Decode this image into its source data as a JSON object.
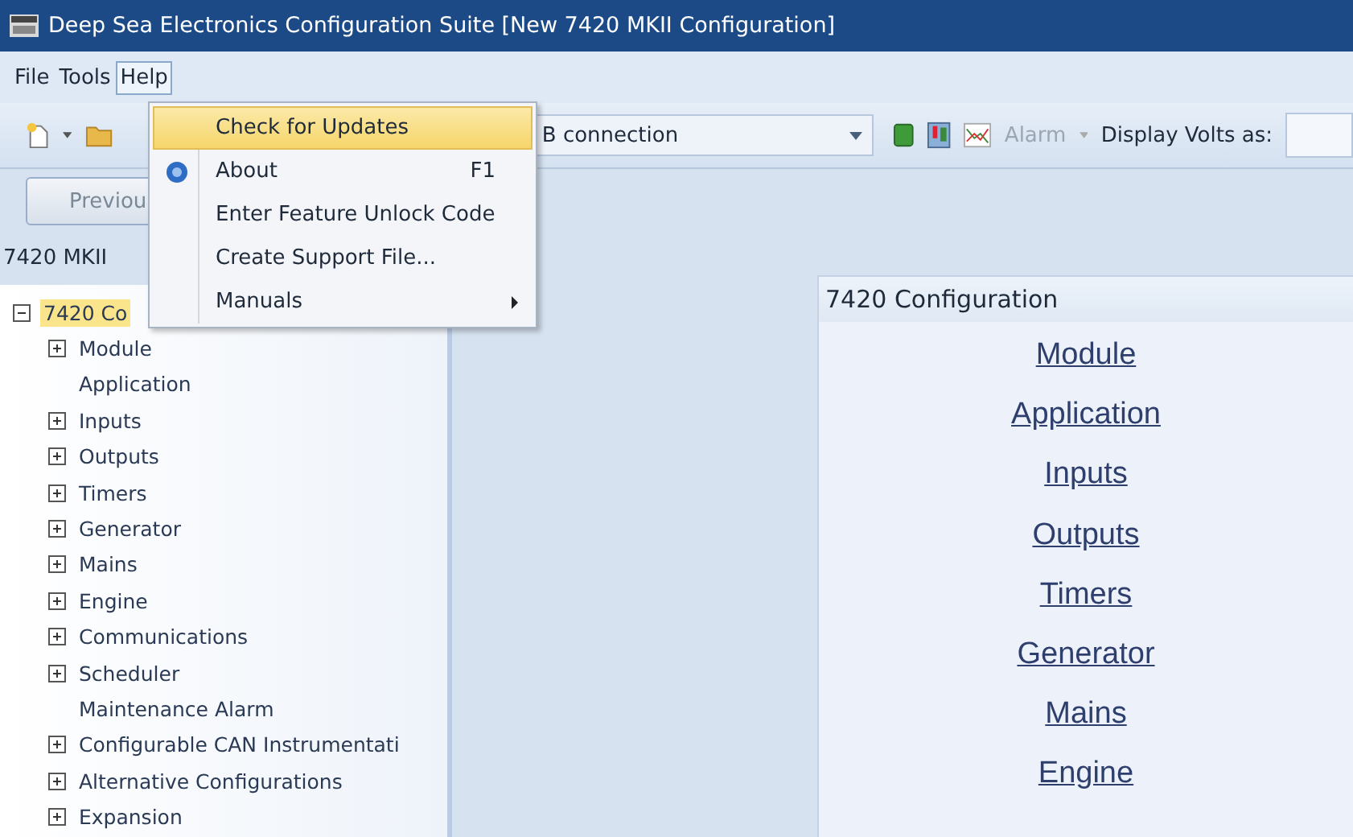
{
  "window": {
    "title": "Deep Sea Electronics Configuration Suite [New 7420 MKII Configuration]"
  },
  "menu_bar": [
    {
      "label": "File",
      "selected": false
    },
    {
      "label": "Tools",
      "selected": false
    },
    {
      "label": "Help",
      "selected": true
    }
  ],
  "help_menu": [
    {
      "label": "Check for Updates",
      "selected": true,
      "icon": false
    },
    {
      "label": "About",
      "shortcut": "F1",
      "selected": false,
      "icon": true
    },
    {
      "label": "Enter Feature Unlock Code",
      "selected": false,
      "icon": false
    },
    {
      "label": "Create Support File...",
      "selected": false,
      "icon": false
    },
    {
      "label": "Manuals",
      "submenu": true,
      "selected": false,
      "icon": false
    }
  ],
  "toolbar": {
    "connection": "B connection",
    "alarm": {
      "label": "Alarm",
      "disabled": true
    },
    "volts_label": "Display Volts as:"
  },
  "previous_button": "Previou",
  "tree": {
    "header": "7420 MKII",
    "root": {
      "label": "7420 Co",
      "selected": true,
      "expanded": true,
      "children": [
        {
          "label": "Module",
          "kind": "group"
        },
        {
          "label": "Application",
          "kind": "leaf"
        },
        {
          "label": "Inputs",
          "kind": "group"
        },
        {
          "label": "Outputs",
          "kind": "group"
        },
        {
          "label": "Timers",
          "kind": "group"
        },
        {
          "label": "Generator",
          "kind": "group"
        },
        {
          "label": "Mains",
          "kind": "group"
        },
        {
          "label": "Engine",
          "kind": "group"
        },
        {
          "label": "Communications",
          "kind": "group"
        },
        {
          "label": "Scheduler",
          "kind": "group"
        },
        {
          "label": "Maintenance Alarm",
          "kind": "leaf"
        },
        {
          "label": "Configurable CAN Instrumentati",
          "kind": "group"
        },
        {
          "label": "Alternative Configurations",
          "kind": "group"
        },
        {
          "label": "Expansion",
          "kind": "group"
        }
      ]
    }
  },
  "config_panel": {
    "title": "7420 Configuration",
    "links": [
      "Module",
      "Application",
      "Inputs",
      "Outputs",
      "Timers",
      "Generator",
      "Mains",
      "Engine"
    ]
  }
}
